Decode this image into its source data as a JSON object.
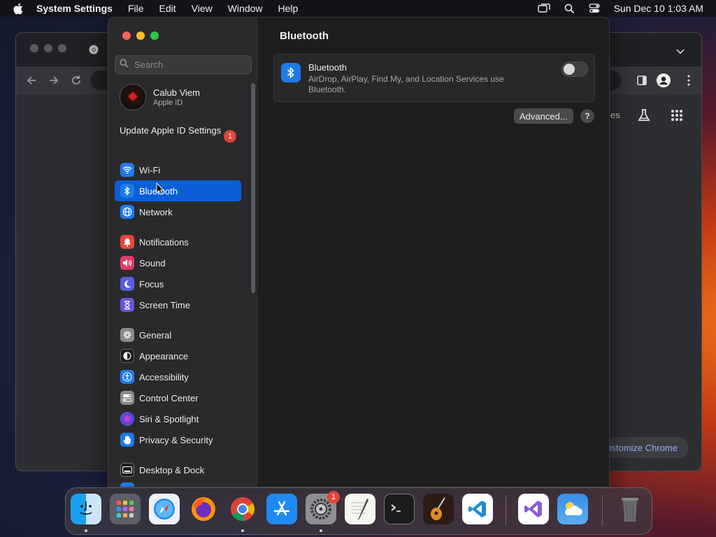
{
  "menubar": {
    "app_name": "System Settings",
    "menus": [
      "File",
      "Edit",
      "View",
      "Window",
      "Help"
    ],
    "datetime": "Sun Dec 10  1:03 AM"
  },
  "browser": {
    "customize_label": "ustomize Chrome",
    "partial_label": "es"
  },
  "sidebar": {
    "search_placeholder": "Search",
    "account_name": "Calub Viem",
    "account_sub": "Apple ID",
    "update_label": "Update Apple ID Settings",
    "update_badge": "1",
    "items": [
      {
        "label": "Wi-Fi",
        "icon": "wifi-icon"
      },
      {
        "label": "Bluetooth",
        "icon": "bluetooth-icon"
      },
      {
        "label": "Network",
        "icon": "globe-icon"
      },
      {
        "label": "Notifications",
        "icon": "bell-icon"
      },
      {
        "label": "Sound",
        "icon": "speaker-icon"
      },
      {
        "label": "Focus",
        "icon": "moon-icon"
      },
      {
        "label": "Screen Time",
        "icon": "hourglass-icon"
      },
      {
        "label": "General",
        "icon": "gear-icon"
      },
      {
        "label": "Appearance",
        "icon": "appearance-icon"
      },
      {
        "label": "Accessibility",
        "icon": "accessibility-icon"
      },
      {
        "label": "Control Center",
        "icon": "toggles-icon"
      },
      {
        "label": "Siri & Spotlight",
        "icon": "siri-icon"
      },
      {
        "label": "Privacy & Security",
        "icon": "hand-icon"
      },
      {
        "label": "Desktop & Dock",
        "icon": "dock-icon"
      }
    ],
    "selected": "Bluetooth"
  },
  "main": {
    "title": "Bluetooth",
    "card_title": "Bluetooth",
    "card_desc": "AirDrop, AirPlay, Find My, and Location Services use Bluetooth.",
    "toggle_on": false,
    "advanced_label": "Advanced...",
    "help_label": "?"
  },
  "dock": {
    "apps": [
      "Finder",
      "Launchpad",
      "Safari",
      "Firefox",
      "Chrome",
      "App Store",
      "System Settings",
      "TextEdit",
      "Terminal",
      "GarageBand",
      "Visual Studio Code",
      "Visual Studio",
      "Weather",
      "Trash"
    ],
    "settings_badge": "1"
  },
  "colors": {
    "accent": "#0a5fd6",
    "badge": "#e0443c"
  }
}
